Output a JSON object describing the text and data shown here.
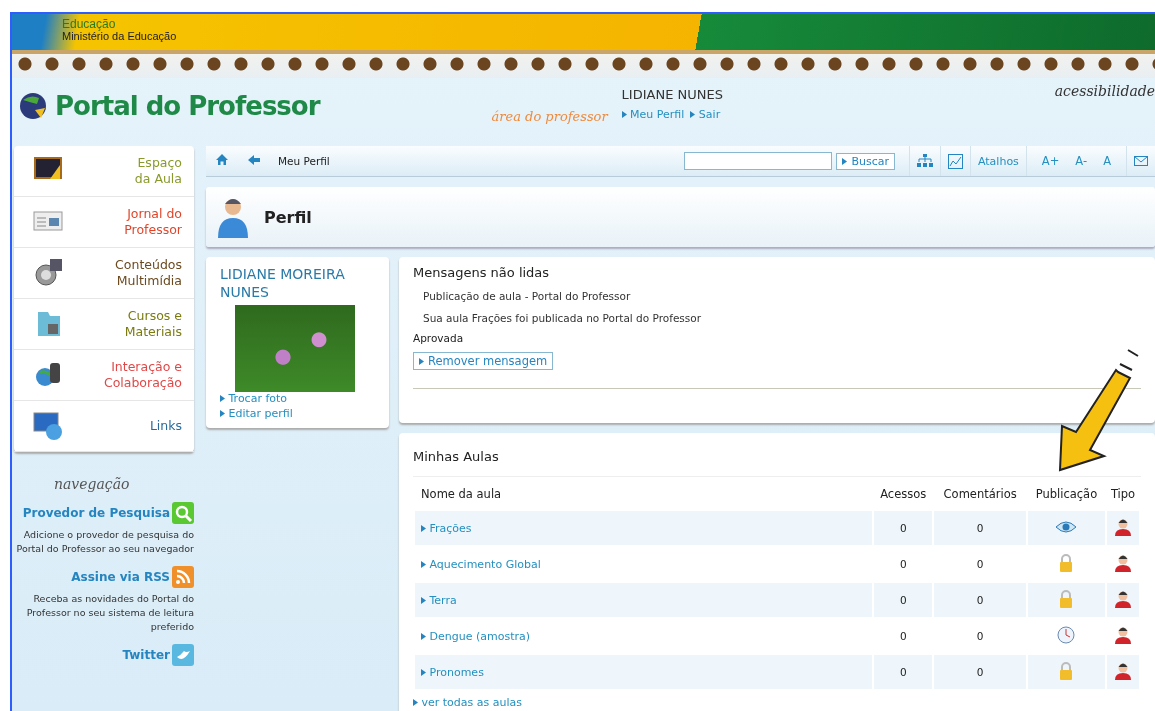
{
  "gov_banner": {
    "title": "Educação",
    "subtitle": "Ministério da Educação"
  },
  "header": {
    "logo": "Portal do Professor",
    "area_label": "área do professor",
    "user_name": "LIDIANE NUNES",
    "user_links": [
      "Meu Perfil",
      "Sair"
    ],
    "accessibility_label": "acessibilidade"
  },
  "sidebar": {
    "items": [
      {
        "label": "Espaço\nda Aula",
        "color": "#8a9a2a"
      },
      {
        "label": "Jornal do\nProfessor",
        "color": "#e0452a"
      },
      {
        "label": "Conteúdos\nMultimídia",
        "color": "#6b4a1f"
      },
      {
        "label": "Cursos e\nMateriais",
        "color": "#7a7a10"
      },
      {
        "label": "Interação e\nColaboração",
        "color": "#e04848"
      },
      {
        "label": "Links",
        "color": "#2a6a9a"
      }
    ],
    "nav_label": "navegação",
    "promos": [
      {
        "title": "Provedor de Pesquisa",
        "text": "Adicione o provedor de pesquisa do Portal do Professor ao seu navegador"
      },
      {
        "title": "Assine via RSS",
        "text": "Receba as novidades do Portal do Professor no seu sistema de leitura preferido"
      },
      {
        "title": "Twitter"
      }
    ]
  },
  "toolbar": {
    "breadcrumb": "Meu Perfil",
    "search_button": "Buscar",
    "shortcuts": "Atalhos",
    "font_controls": [
      "A+",
      "A-",
      "A"
    ]
  },
  "page_title": "Perfil",
  "profile": {
    "name": "LIDIANE MOREIRA NUNES",
    "links": [
      "Trocar foto",
      "Editar perfil"
    ]
  },
  "messages": {
    "title": "Mensagens não lidas",
    "subject": "Publicação de aula - Portal do Professor",
    "body": "Sua aula Frações foi publicada no Portal do Professor",
    "status": "Aprovada",
    "remove_button": "Remover mensagem"
  },
  "lessons": {
    "title": "Minhas Aulas",
    "columns": [
      "Nome da aula",
      "Acessos",
      "Comentários",
      "Publicação",
      "Tipo"
    ],
    "rows": [
      {
        "name": "Frações",
        "accesses": "0",
        "comments": "0",
        "kind": "visible"
      },
      {
        "name": "Aquecimento Global",
        "accesses": "0",
        "comments": "0",
        "kind": "locked"
      },
      {
        "name": "Terra",
        "accesses": "0",
        "comments": "0",
        "kind": "locked"
      },
      {
        "name": "Dengue (amostra)",
        "accesses": "0",
        "comments": "0",
        "kind": "pending"
      },
      {
        "name": "Pronomes",
        "accesses": "0",
        "comments": "0",
        "kind": "locked"
      }
    ],
    "see_all": "ver todas as aulas"
  }
}
